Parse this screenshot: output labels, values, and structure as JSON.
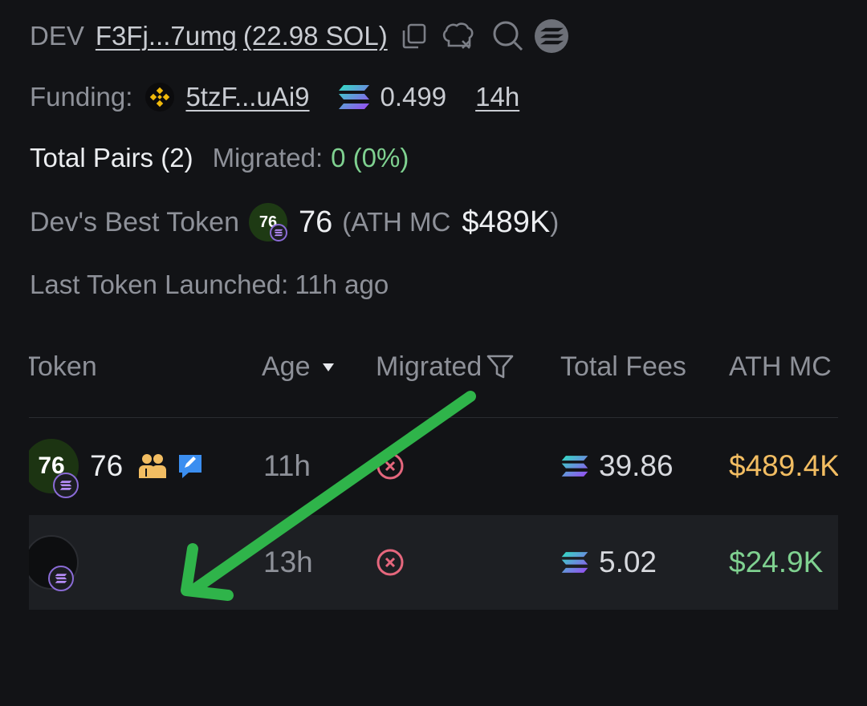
{
  "dev": {
    "label": "DEV",
    "address": "F3Fj...7umg",
    "balance": "(22.98 SOL)"
  },
  "funding": {
    "label": "Funding:",
    "address": "5tzF...uAi9",
    "amount": "0.499",
    "time": "14h"
  },
  "pairs": {
    "total_label": "Total Pairs (2)",
    "migrated_label": "Migrated:",
    "migrated_value": "0 (0%)"
  },
  "best": {
    "label": "Dev's Best Token",
    "token_name": "76",
    "token_logo_text": "76",
    "ath_open": "(ATH MC",
    "ath_value": "$489K",
    "ath_close": ")"
  },
  "last": {
    "label": "Last Token Launched:",
    "value": "11h ago"
  },
  "table": {
    "headers": [
      "Token",
      "Age",
      "Migrated",
      "Total Fees",
      "ATH MC"
    ],
    "rows": [
      {
        "token": "76",
        "logo_text": "76",
        "age": "11h",
        "fees": "39.86",
        "ath_mc": "$489.4K"
      },
      {
        "token": "",
        "logo_text": "",
        "age": "13h",
        "fees": "5.02",
        "ath_mc": "$24.9K"
      }
    ]
  },
  "colors": {
    "background": "#121316",
    "migrated_green": "#7fd190",
    "ath_gold": "#f2bd62",
    "not_migrated_red": "#e5677d",
    "annotation_arrow": "#2fb44a"
  }
}
